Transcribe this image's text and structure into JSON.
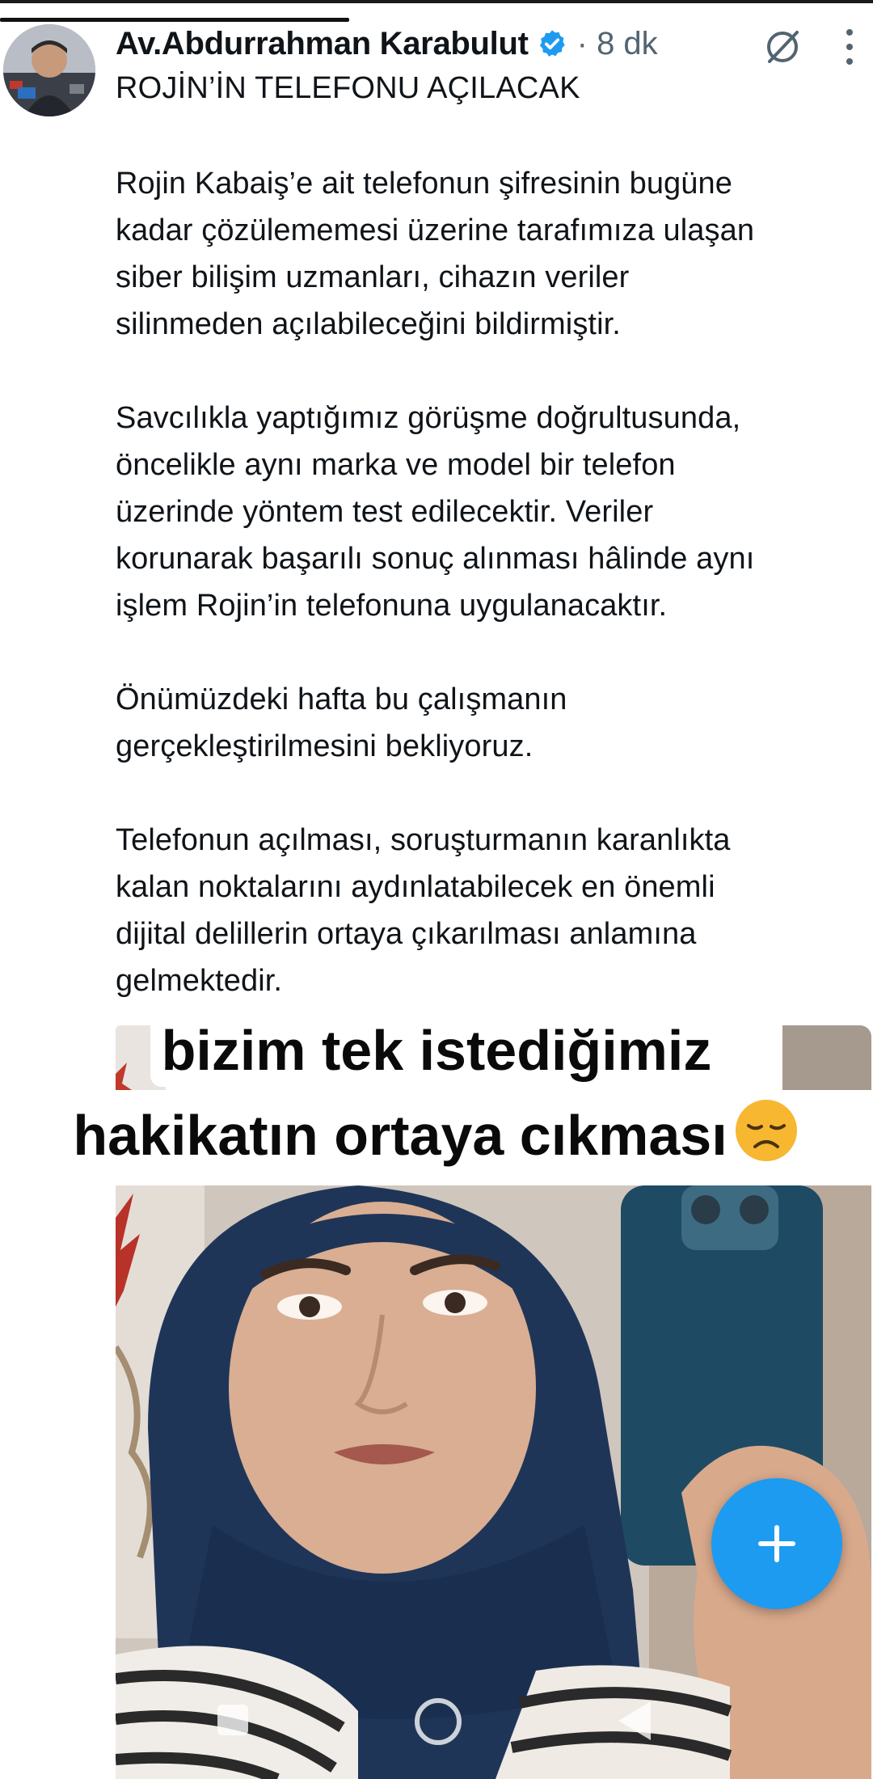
{
  "post": {
    "author_name": "Av.Abdurrahman Karabulut",
    "time": "· 8 dk",
    "title": "ROJİN’İN TELEFONU AÇILACAK",
    "paragraphs": [
      "Rojin Kabaiş’e ait telefonun şifresinin bugüne\nkadar çözülememesi üzerine tarafımıza ulaşan\nsiber bilişim uzmanları, cihazın veriler\nsilinmeden açılabileceğini bildirmiştir.",
      "Savcılıkla yaptığımız görüşme doğrultusunda,\nöncelikle aynı marka ve model bir telefon\nüzerinde yöntem test edilecektir. Veriler\nkorunarak başarılı sonuç alınması hâlinde aynı\nişlem Rojin’in telefonuna uygulanacaktır.",
      "Önümüzdeki hafta bu çalışmanın\ngerçekleştirilmesini bekliyoruz.",
      "Telefonun açılması, soruşturmanın karanlıkta\nkalan noktalarını aydınlatabilecek en önemli\ndijital delillerin ortaya çıkarılması anlamına\ngelmektedir."
    ]
  },
  "caption": {
    "line1": "bizim tek istediğimiz",
    "line2": "hakikatın ortaya cıkması"
  },
  "icons": {
    "verified": "verified-badge-icon",
    "grok": "grok-icon",
    "more": "more-vertical-icon",
    "emoji": "disappointed-face-emoji",
    "fab": "plus-icon",
    "nav": [
      "recents-square-icon",
      "home-circle-icon",
      "back-triangle-icon"
    ]
  },
  "progress": 0.4,
  "colors": {
    "accent": "#1d9bf0",
    "text": "#0f1419",
    "muted": "#536471",
    "verified": "#1d9bf0"
  }
}
